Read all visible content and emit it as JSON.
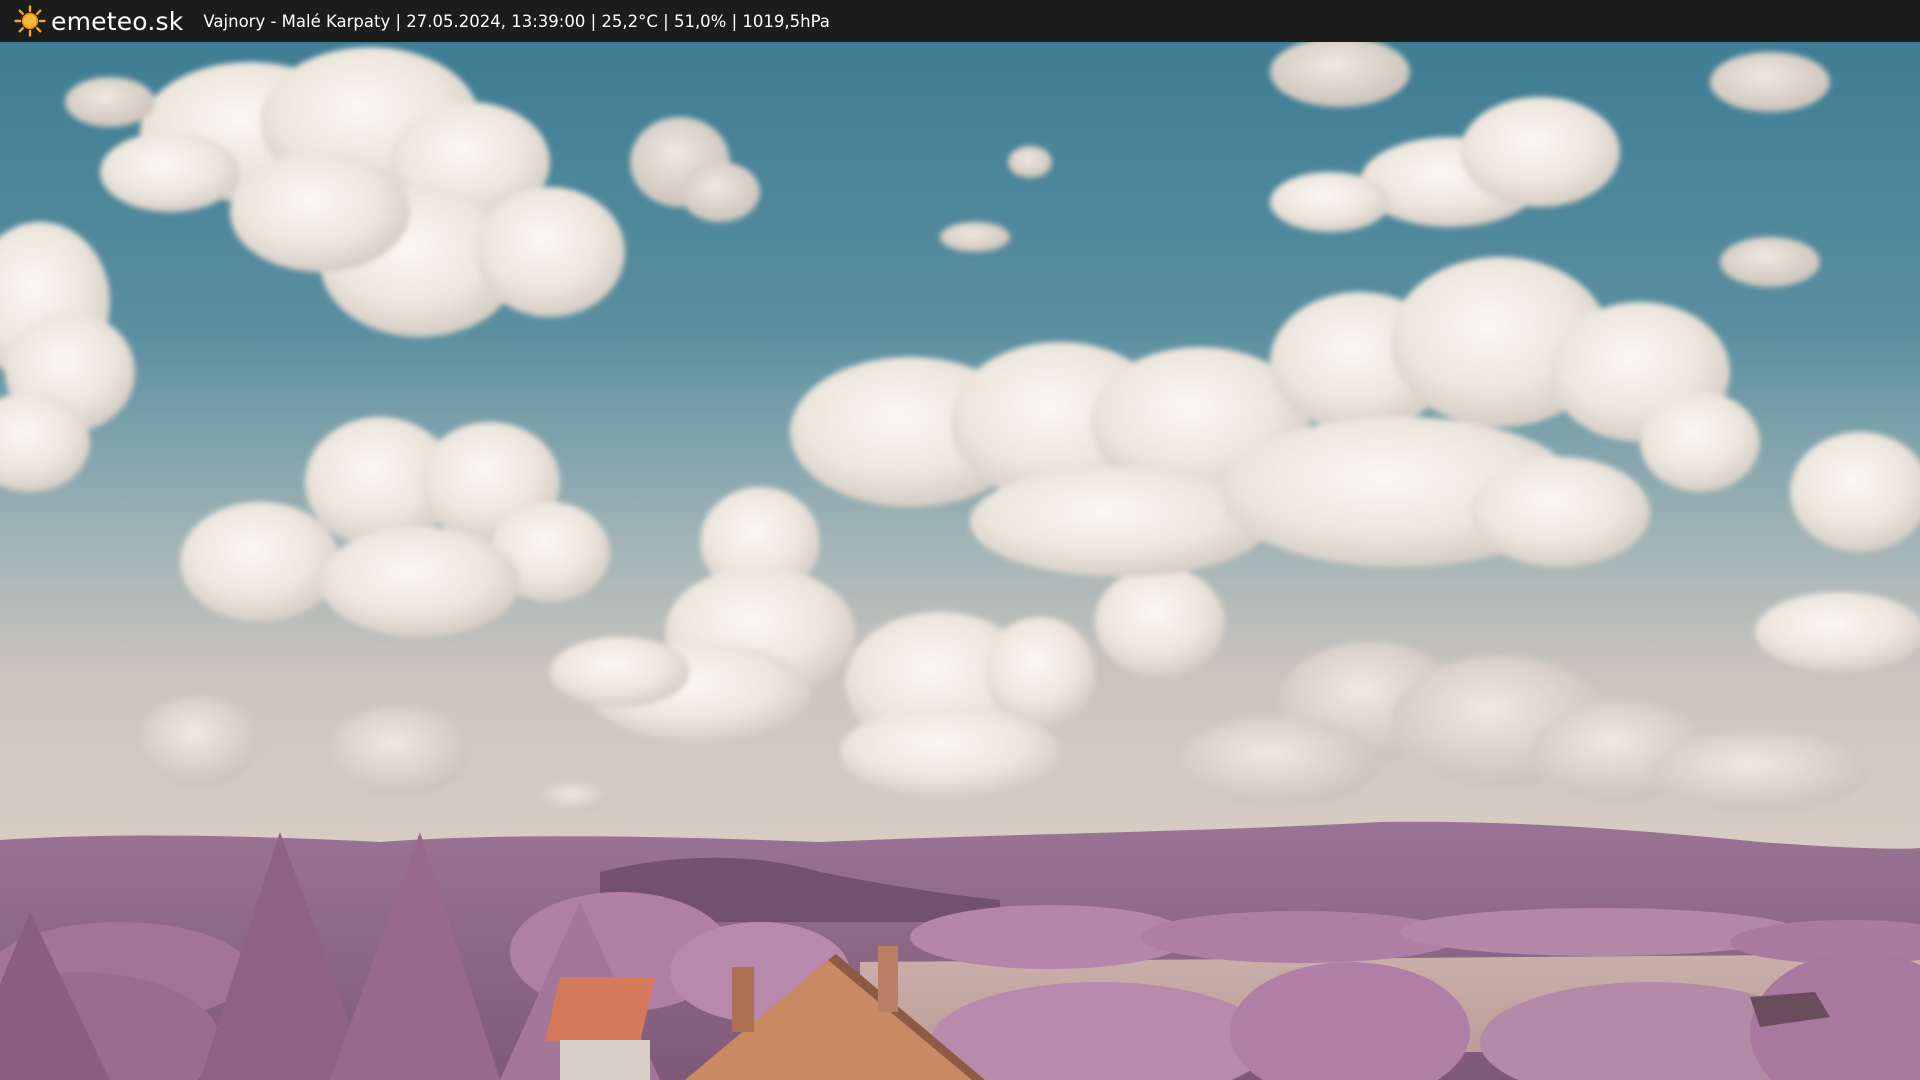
{
  "header": {
    "logo_text": "emeteo.sk",
    "caption": "Vajnory - Malé Karpaty | 27.05.2024, 13:39:00 | 25,2°C | 51,0% | 1019,5hPa",
    "logo_icon": "sun-icon"
  },
  "colors": {
    "bar": "#1c1c1c",
    "sun": "#f5a623",
    "sky_top": "#3f7f95",
    "sky_bottom": "#c9c2bb",
    "hills": "#9a6e92",
    "trees": "#b07ba2",
    "roof": "#d47a5a",
    "field": "#c9a9a6"
  }
}
